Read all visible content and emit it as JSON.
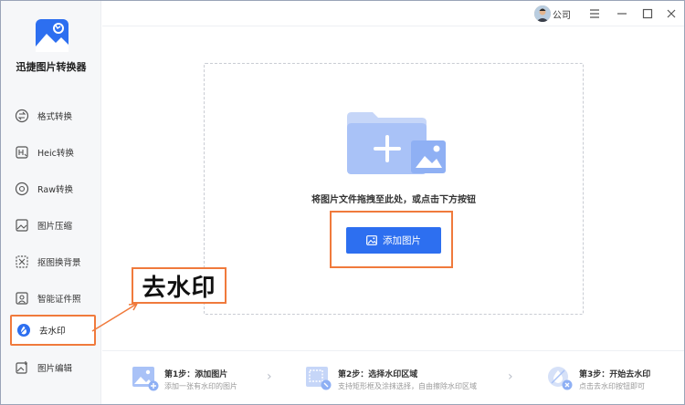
{
  "app": {
    "title": "迅捷图片转换器"
  },
  "titlebar": {
    "account": "公司",
    "menu_icon": "hamburger-icon",
    "minimize_icon": "minimize-icon",
    "maximize_icon": "maximize-icon",
    "close_icon": "close-icon"
  },
  "sidebar": {
    "items": [
      {
        "label": "格式转换",
        "icon": "format-convert-icon"
      },
      {
        "label": "Heic转换",
        "icon": "heic-icon"
      },
      {
        "label": "Raw转换",
        "icon": "raw-icon"
      },
      {
        "label": "图片压缩",
        "icon": "compress-icon"
      },
      {
        "label": "抠图换背景",
        "icon": "cutout-icon"
      },
      {
        "label": "智能证件照",
        "icon": "id-photo-icon"
      },
      {
        "label": "去水印",
        "icon": "watermark-icon",
        "active": true
      },
      {
        "label": "图片编辑",
        "icon": "image-edit-icon"
      }
    ]
  },
  "main": {
    "drop_text": "将图片文件拖拽至此处，或点击下方按钮",
    "add_button": "添加图片"
  },
  "callout": {
    "text": "去水印"
  },
  "steps": [
    {
      "title": "第1步：添加图片",
      "desc": "添加一张有水印的图片"
    },
    {
      "title": "第2步：选择水印区域",
      "desc": "支持矩形框及涂抹选择，自由擦除水印区域"
    },
    {
      "title": "第3步：开始去水印",
      "desc": "点击去水印按钮即可"
    }
  ],
  "colors": {
    "accent": "#2d6ff0",
    "annotation": "#f07a3c",
    "icon_light": "#a9c2f7"
  }
}
